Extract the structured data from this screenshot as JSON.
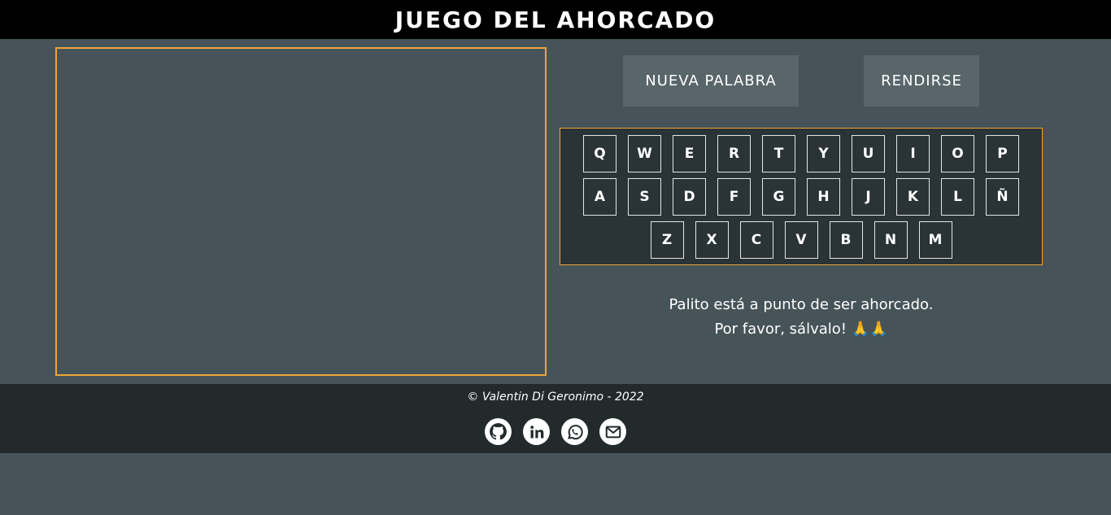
{
  "header": {
    "title": "JUEGO DEL AHORCADO"
  },
  "buttons": {
    "new_word": "NUEVA PALABRA",
    "give_up": "RENDIRSE"
  },
  "keyboard": {
    "row1": [
      "Q",
      "W",
      "E",
      "R",
      "T",
      "Y",
      "U",
      "I",
      "O",
      "P"
    ],
    "row2": [
      "A",
      "S",
      "D",
      "F",
      "G",
      "H",
      "J",
      "K",
      "L",
      "Ñ"
    ],
    "row3": [
      "Z",
      "X",
      "C",
      "V",
      "B",
      "N",
      "M"
    ]
  },
  "message": {
    "line1": "Palito está a punto de ser ahorcado.",
    "line2": "Por favor, sálvalo! 🙏🙏"
  },
  "footer": {
    "copyright": "© Valentin Di Geronimo - 2022",
    "social_icons": [
      "github-icon",
      "linkedin-icon",
      "whatsapp-icon",
      "email-icon"
    ]
  },
  "colors": {
    "accent": "#f0a43a",
    "background": "#465459",
    "header": "#000000",
    "footer": "#222a2c",
    "button": "#58666b"
  }
}
